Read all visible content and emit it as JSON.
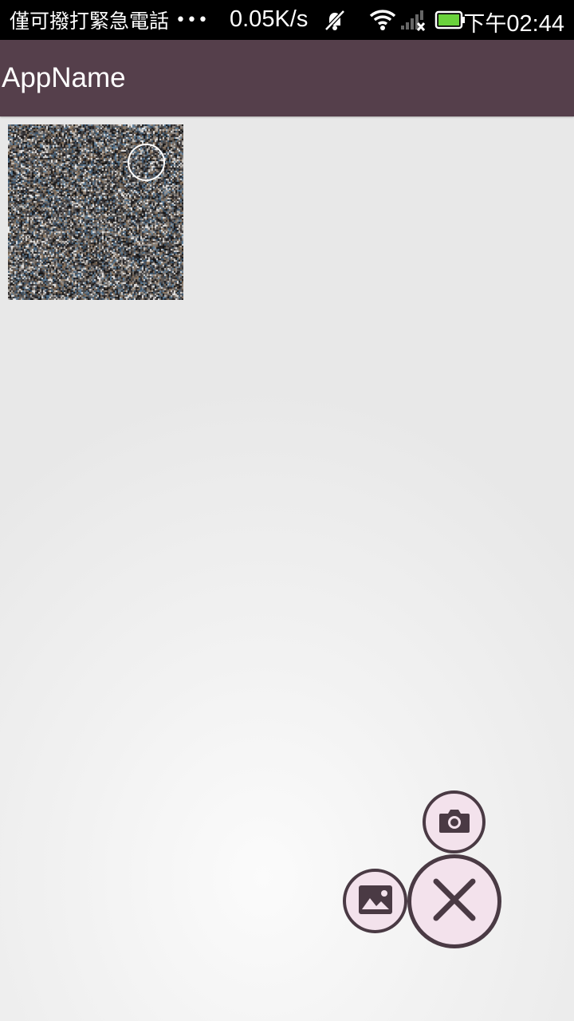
{
  "status_bar": {
    "carrier_text": "僅可撥打緊急電話",
    "more_dots": "•••",
    "net_speed": "0.05K/s",
    "time_prefix": "下午",
    "time": "02:44",
    "icons": [
      "muted-notification-icon",
      "wifi-icon",
      "no-signal-icon",
      "battery-icon"
    ],
    "battery_color": "#6ad23c"
  },
  "app_bar": {
    "title": "AppName",
    "color": "#553f4b"
  },
  "content": {
    "thumbnail": {
      "alt": "noise image thumbnail"
    }
  },
  "fab_menu": {
    "accent_fill": "#f3e2ec",
    "accent_stroke": "#4a3a44",
    "items": [
      {
        "name": "camera",
        "icon": "camera-icon"
      },
      {
        "name": "gallery",
        "icon": "image-icon"
      },
      {
        "name": "close",
        "icon": "close-icon"
      }
    ]
  }
}
